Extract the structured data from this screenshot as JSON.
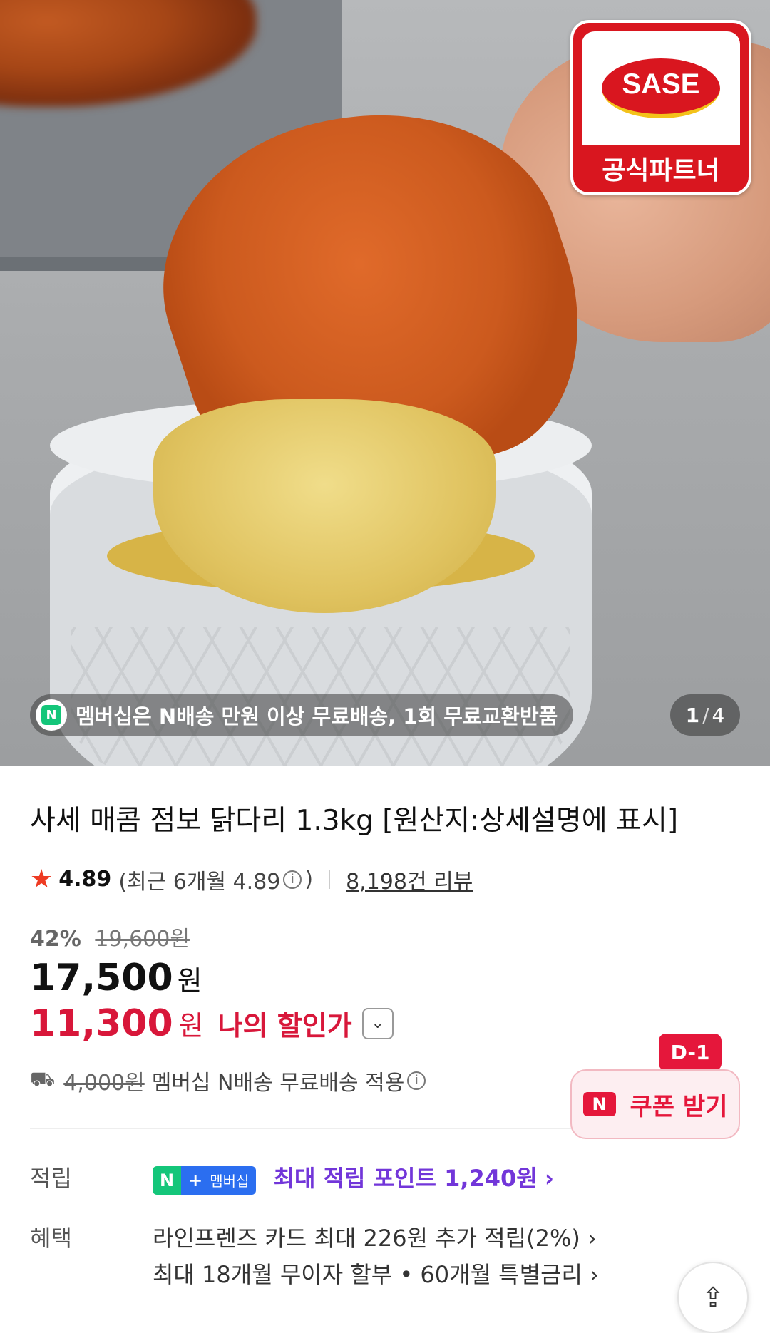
{
  "hero": {
    "badge_brand": "SASE",
    "badge_label": "공식파트너",
    "membership_notice": "멤버십은 N배송 만원 이상 무료배송, 1회 무료교환반품",
    "npay_icon": "N",
    "image_index": "1",
    "image_total": "4"
  },
  "product": {
    "title": "사세 매콤 점보 닭다리 1.3kg [원산지:상세설명에 표시]",
    "rating": "4.89",
    "recent_rating_prefix": "(최근 6개월 4.89",
    "recent_rating_suffix": ")",
    "review_count": "8,198건 리뷰",
    "discount_pct": "42%",
    "original_price": "19,600원",
    "price": "17,500",
    "price_unit": "원",
    "my_price": "11,300",
    "my_price_unit": "원",
    "my_price_label": "나의 할인가"
  },
  "coupon": {
    "dday": "D-1",
    "n_icon": "N",
    "label": "쿠폰 받기"
  },
  "shipping": {
    "old_fee": "4,000원",
    "text": "멤버십 N배송 무료배송 적용"
  },
  "benefits": {
    "points_label": "적립",
    "badge_n": "N",
    "badge_plus": "+",
    "badge_membership": "멤버십",
    "points_text": "최대 적립 포인트 1,240원",
    "benefit_label": "혜택",
    "line1": "라인프렌즈 카드 최대 226원 추가 적립(2%)",
    "line2": "최대 18개월 무이자 할부 • 60개월 특별금리"
  },
  "icons": {
    "star": "star-icon",
    "info": "info-icon",
    "truck": "truck-icon",
    "chevron": "chevron-right-icon",
    "share": "share-icon"
  },
  "colors": {
    "accent_red": "#e5173b",
    "points_purple": "#7236d9",
    "npay_green": "#14c67a"
  }
}
